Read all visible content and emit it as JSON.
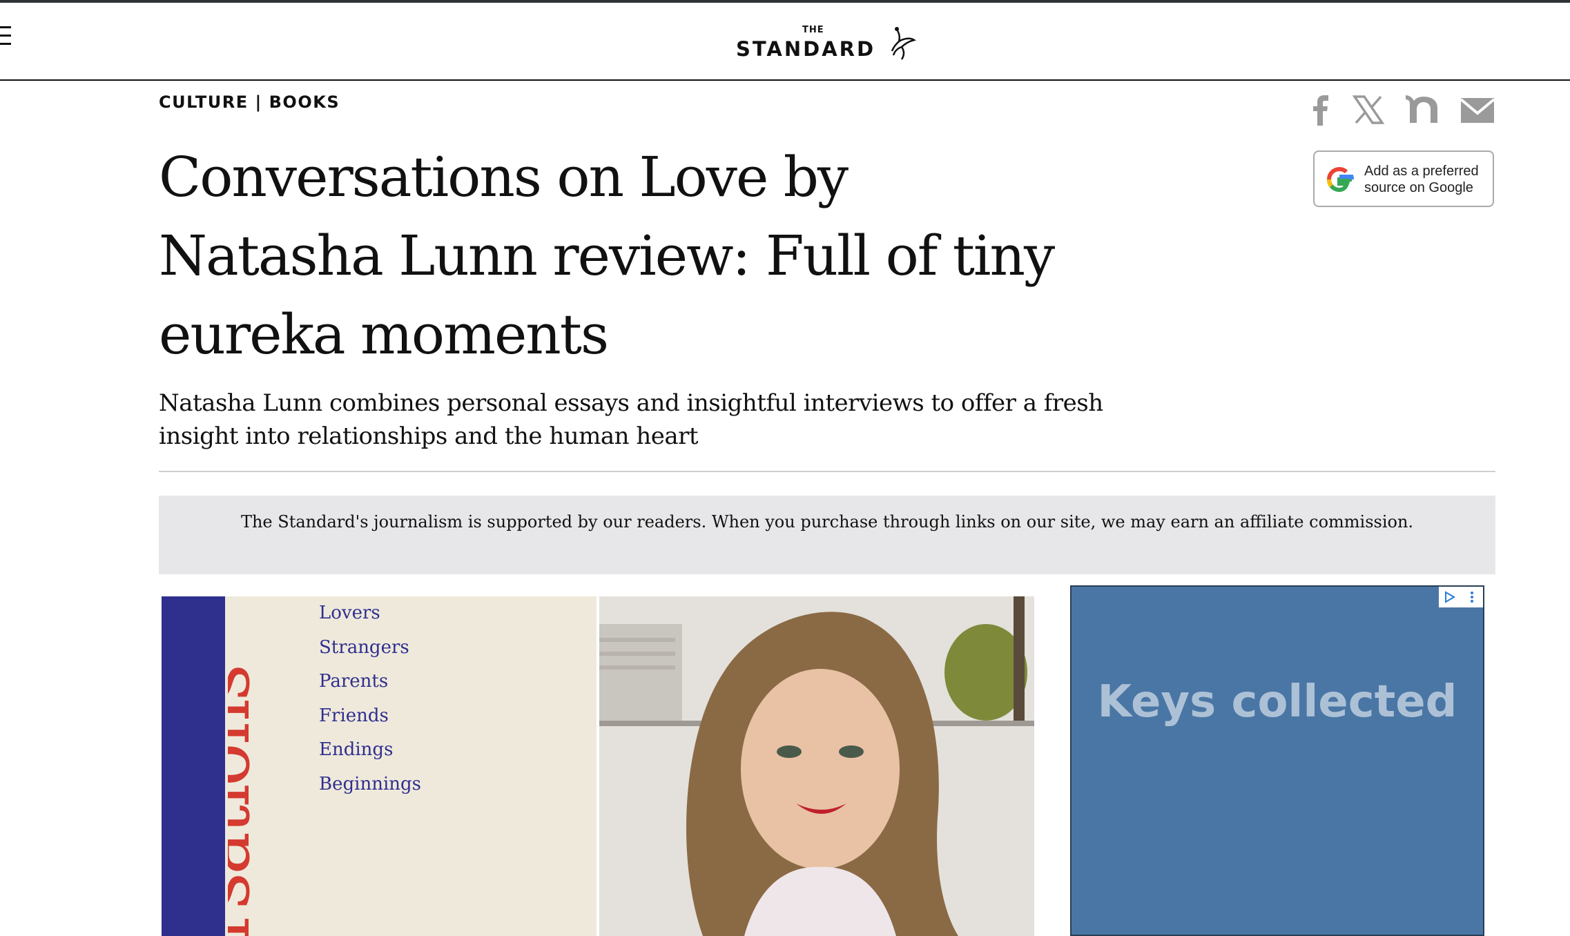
{
  "header": {
    "logo_the": "THE",
    "logo_main": "STANDARD",
    "menu_icon": "hamburger-menu-icon"
  },
  "article": {
    "section": "CULTURE | BOOKS",
    "headline": "Conversations on Love by Natasha Lunn review: Full of tiny eureka moments",
    "standfirst": "Natasha Lunn combines personal essays and insightful interviews to offer a fresh insight into relationships and the human heart"
  },
  "share": {
    "icons": [
      "facebook-icon",
      "x-icon",
      "nextdoor-icon",
      "email-icon"
    ],
    "icon_color": "#9a9a9a"
  },
  "google_source": {
    "label": "Add as a preferred source on Google"
  },
  "affiliate_notice": "The Standard's journalism is supported by our readers. When you purchase through links on our site, we may earn an affiliate commission.",
  "hero": {
    "cover_title_fragment": "rsations",
    "cover_list": [
      "Lovers",
      "Strangers",
      "Parents",
      "Friends",
      "Endings",
      "Beginnings"
    ]
  },
  "ad": {
    "text": "Keys collected",
    "background": "#4a76a5"
  },
  "colors": {
    "accent_red": "#d43a2f",
    "cover_blue": "#2f2f8e",
    "notice_bg": "#e7e7e9"
  }
}
